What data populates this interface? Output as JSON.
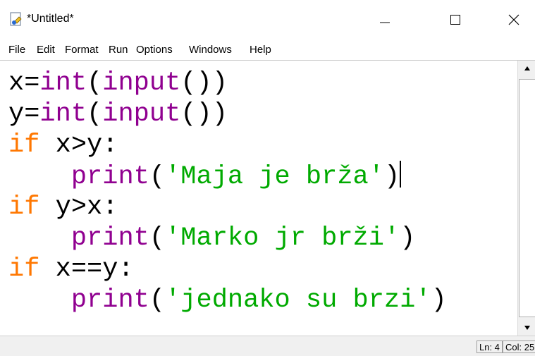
{
  "window": {
    "title": "*Untitled*",
    "controls": [
      "minimize",
      "maximize",
      "close"
    ]
  },
  "menu": [
    "File",
    "Edit",
    "Format",
    "Run",
    "Options",
    "Windows",
    "Help"
  ],
  "code": [
    {
      "tokens": [
        {
          "t": "x=",
          "c": "plain"
        },
        {
          "t": "int",
          "c": "builtin"
        },
        {
          "t": "(",
          "c": "plain"
        },
        {
          "t": "input",
          "c": "builtin"
        },
        {
          "t": "())",
          "c": "plain"
        }
      ]
    },
    {
      "tokens": [
        {
          "t": "y=",
          "c": "plain"
        },
        {
          "t": "int",
          "c": "builtin"
        },
        {
          "t": "(",
          "c": "plain"
        },
        {
          "t": "input",
          "c": "builtin"
        },
        {
          "t": "())",
          "c": "plain"
        }
      ]
    },
    {
      "tokens": [
        {
          "t": "if",
          "c": "keyword"
        },
        {
          "t": " x>y:",
          "c": "plain"
        }
      ]
    },
    {
      "tokens": [
        {
          "t": "    ",
          "c": "plain"
        },
        {
          "t": "print",
          "c": "builtin"
        },
        {
          "t": "(",
          "c": "plain"
        },
        {
          "t": "'Maja je brža'",
          "c": "string"
        },
        {
          "t": ")",
          "c": "plain"
        }
      ],
      "cursor": true
    },
    {
      "tokens": [
        {
          "t": "if",
          "c": "keyword"
        },
        {
          "t": " y>x:",
          "c": "plain"
        }
      ]
    },
    {
      "tokens": [
        {
          "t": "    ",
          "c": "plain"
        },
        {
          "t": "print",
          "c": "builtin"
        },
        {
          "t": "(",
          "c": "plain"
        },
        {
          "t": "'Marko jr brži'",
          "c": "string"
        },
        {
          "t": ")",
          "c": "plain"
        }
      ]
    },
    {
      "tokens": [
        {
          "t": "if",
          "c": "keyword"
        },
        {
          "t": " x==y:",
          "c": "plain"
        }
      ]
    },
    {
      "tokens": [
        {
          "t": "    ",
          "c": "plain"
        },
        {
          "t": "print",
          "c": "builtin"
        },
        {
          "t": "(",
          "c": "plain"
        },
        {
          "t": "'jednako su brzi'",
          "c": "string"
        },
        {
          "t": ")",
          "c": "plain"
        }
      ]
    }
  ],
  "colors": {
    "keyword": "#ff7700",
    "builtin": "#900090",
    "string": "#00aa00",
    "plain": "#000000"
  },
  "status": {
    "line": "Ln: 4",
    "col": "Col: 25"
  }
}
